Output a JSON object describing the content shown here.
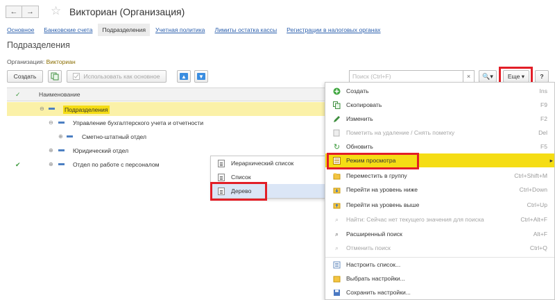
{
  "window": {
    "title": "Викториан (Организация)",
    "back_icon": "←",
    "forward_icon": "→",
    "star_icon": "☆"
  },
  "tabs": [
    "Основное",
    "Банковские счета",
    "Подразделения",
    "Учетная политика",
    "Лимиты остатка кассы",
    "Регистрации в налоговых органах"
  ],
  "section_title": "Подразделения",
  "org": {
    "label": "Организация:",
    "value": "Викториан"
  },
  "toolbar": {
    "create": "Создать",
    "use_main": "Использовать как основное",
    "search_placeholder": "Поиск (Ctrl+F)",
    "clear": "×",
    "find_icon": "🔍▾",
    "more": "Еще ▾",
    "help": "?"
  },
  "table": {
    "columns": [
      "✓",
      "Наименование"
    ],
    "rows": [
      {
        "expander": "⊖",
        "name": "Подразделения",
        "checked": false,
        "selected": true
      },
      {
        "expander": "⊖",
        "name": "Управление бухгалтерского учета и отчетности",
        "checked": false,
        "selected": false
      },
      {
        "expander": "⊕",
        "name": "Сметно-штатный отдел",
        "checked": false,
        "selected": false
      },
      {
        "expander": "⊕",
        "name": "Юридический отдел",
        "checked": false,
        "selected": false
      },
      {
        "expander": "⊕",
        "name": "Отдел по работе с персоналом",
        "checked": true,
        "selected": false
      }
    ]
  },
  "view_submenu": [
    "Иерархический список",
    "Список",
    "Дерево"
  ],
  "menu": [
    {
      "label": "Создать",
      "shortcut": "Ins",
      "icon": "plus-icon",
      "disabled": false
    },
    {
      "label": "Скопировать",
      "shortcut": "F9",
      "icon": "copy-icon",
      "disabled": false
    },
    {
      "label": "Изменить",
      "shortcut": "F2",
      "icon": "pencil-icon",
      "disabled": false
    },
    {
      "label": "Пометить на удаление / Снять пометку",
      "shortcut": "Del",
      "icon": "delete-mark-icon",
      "disabled": true
    },
    {
      "label": "Обновить",
      "shortcut": "F5",
      "icon": "refresh-icon",
      "disabled": false
    },
    {
      "label": "Режим просмотра",
      "shortcut": "▸",
      "icon": "view-mode-icon",
      "disabled": false,
      "highlighted": true
    },
    {
      "label": "Переместить в группу",
      "shortcut": "Ctrl+Shift+M",
      "icon": "move-group-icon",
      "disabled": false
    },
    {
      "label": "Перейти на уровень ниже",
      "shortcut": "Ctrl+Down",
      "icon": "level-down-icon",
      "disabled": false
    },
    {
      "label": "Перейти на уровень выше",
      "shortcut": "Ctrl+Up",
      "icon": "level-up-icon",
      "disabled": false
    },
    {
      "label": "Найти: Сейчас нет текущего значения для поиска",
      "shortcut": "Ctrl+Alt+F",
      "icon": "find-icon",
      "disabled": true
    },
    {
      "label": "Расширенный поиск",
      "shortcut": "Alt+F",
      "icon": "advanced-search-icon",
      "disabled": false
    },
    {
      "label": "Отменить поиск",
      "shortcut": "Ctrl+Q",
      "icon": "cancel-search-icon",
      "disabled": true
    },
    {
      "label": "Настроить список...",
      "shortcut": "",
      "icon": "settings-list-icon",
      "disabled": false
    },
    {
      "label": "Выбрать настройки...",
      "shortcut": "",
      "icon": "choose-settings-icon",
      "disabled": false
    },
    {
      "label": "Сохранить настройки...",
      "shortcut": "",
      "icon": "save-settings-icon",
      "disabled": false
    }
  ],
  "colors": {
    "highlight": "#f5dd14",
    "selected_row": "#fbf1a8",
    "link": "#2b5fad",
    "annotation": "#e21e27"
  }
}
